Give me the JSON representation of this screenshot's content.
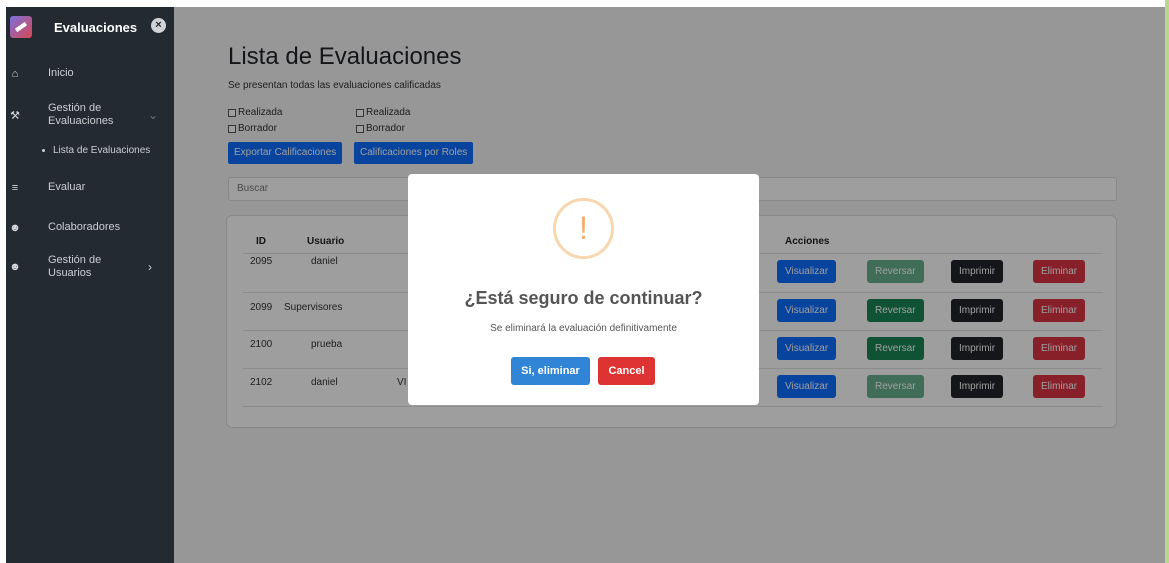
{
  "sidebar": {
    "title": "Evaluaciones",
    "close": "×",
    "items": [
      {
        "label": "Inicio",
        "icon": "home-icon"
      },
      {
        "label": "Gestión de Evaluaciones",
        "icon": "wrench-icon"
      },
      {
        "label": "Evaluar",
        "icon": "list-check-icon"
      },
      {
        "label": "Colaboradores",
        "icon": "users-icon"
      },
      {
        "label": "Gestión de Usuarios",
        "icon": "user-group-icon"
      }
    ],
    "subitem": "Lista de Evaluaciones"
  },
  "main": {
    "title": "Lista de Evaluaciones",
    "subtitle": "Se presentan todas las evaluaciones calificadas",
    "filters": {
      "col1": [
        "Realizada",
        "Borrador"
      ],
      "col2": [
        "Realizada",
        "Borrador"
      ]
    },
    "buttons": {
      "export": "Exportar Calificaciones",
      "roles": "Calificaciones por Roles"
    },
    "search_placeholder": "Buscar",
    "table": {
      "headers": {
        "id": "ID",
        "usuario": "Usuario",
        "acciones": "Acciones"
      },
      "rows": [
        {
          "id": "2095",
          "usuario": "daniel",
          "extra": ""
        },
        {
          "id": "2099",
          "usuario": "Supervisores",
          "extra": ""
        },
        {
          "id": "2100",
          "usuario": "prueba",
          "extra": ""
        },
        {
          "id": "2102",
          "usuario": "daniel",
          "extra": "VI"
        }
      ],
      "actions": {
        "visualizar": "Visualizar",
        "reversar": "Reversar",
        "imprimir": "Imprimir",
        "eliminar": "Eliminar"
      }
    }
  },
  "modal": {
    "icon": "!",
    "title": "¿Está seguro de continuar?",
    "text": "Se eliminará la evaluación definitivamente",
    "confirm": "Si, eliminar",
    "cancel": "Cancel"
  },
  "colors": {
    "sidebar": "#232a31",
    "primary": "#0d6efd",
    "success": "#198754",
    "dark": "#212529",
    "danger": "#dc3545",
    "confirm": "#3085d6",
    "cancel": "#dd3333",
    "warning": "#f0ad6e"
  }
}
